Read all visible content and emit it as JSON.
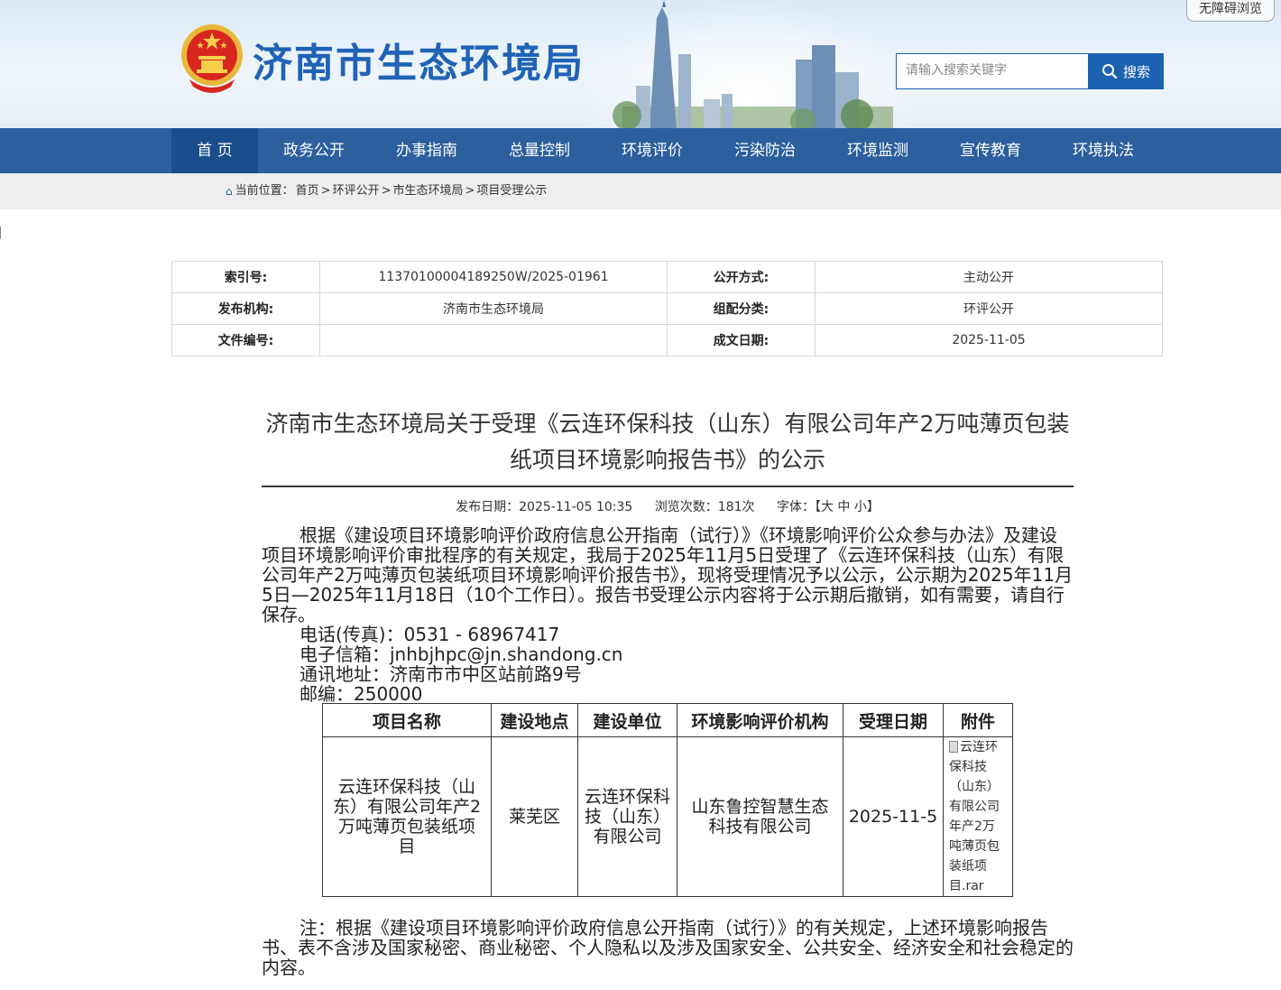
{
  "header": {
    "site_title": "济南市生态环境局",
    "accessibility_label": "无障碍浏览",
    "search": {
      "placeholder": "请输入搜索关键字",
      "button_label": "搜索"
    }
  },
  "nav": {
    "items": [
      "首 页",
      "政务公开",
      "办事指南",
      "总量控制",
      "环境评价",
      "污染防治",
      "环境监测",
      "宣传教育",
      "环境执法"
    ],
    "active": "首 页"
  },
  "breadcrumb": {
    "prefix": "当前位置：",
    "items": [
      "首页",
      "环评公开",
      "市生态环境局",
      "项目受理公示"
    ]
  },
  "meta_table": {
    "rows": [
      {
        "k1": "索引号:",
        "v1": "11370100004189250W/2025-01961",
        "k2": "公开方式:",
        "v2": "主动公开"
      },
      {
        "k1": "发布机构:",
        "v1": "济南市生态环境局",
        "k2": "组配分类:",
        "v2": "环评公开"
      },
      {
        "k1": "文件编号:",
        "v1": "",
        "k2": "成文日期:",
        "v2": "2025-11-05"
      }
    ]
  },
  "article": {
    "title": "济南市生态环境局关于受理《云连环保科技（山东）有限公司年产2万吨薄页包装纸项目环境影响报告书》的公示",
    "publish_date": "发布日期：2025-11-05 10:35",
    "views": "浏览次数：181次",
    "font_size": "字体：【大 中 小】",
    "paragraph": "根据《建设项目环境影响评价政府信息公开指南（试行）》《环境影响评价公众参与办法》及建设项目环境影响评价审批程序的有关规定，我局于2025年11月5日受理了《云连环保科技（山东）有限公司年产2万吨薄页包装纸项目环境影响评价报告书》，现将受理情况予以公示，公示期为2025年11月5日—2025年11月18日（10个工作日）。报告书受理公示内容将于公示期后撤销，如有需要，请自行保存。",
    "phone": "电话(传真)：0531 - 68967417",
    "email": "电子信箱：jnhbjhpc@jn.shandong.cn",
    "address": "通讯地址：济南市市中区站前路9号",
    "postcode": "邮编：250000",
    "note": "注：根据《建设项目环境影响评价政府信息公开指南（试行）》的有关规定，上述环境影响报告书、表不含涉及国家秘密、商业秘密、个人隐私以及涉及国家安全、公共安全、经济安全和社会稳定的内容。"
  },
  "project_table": {
    "headers": [
      "项目名称",
      "建设地点",
      "建设单位",
      "环境影响评价机构",
      "受理日期",
      "附件"
    ],
    "row": {
      "name": "云连环保科技（山东）有限公司年产2万吨薄页包装纸项目",
      "location": "莱芜区",
      "builder": "云连环保科技（山东）有限公司",
      "eia_org": "山东鲁控智慧生态科技有限公司",
      "date": "2025-11-5",
      "attachment": "云连环保科技（山东）有限公司年产2万吨薄页包装纸项目.rar"
    }
  },
  "colors": {
    "brand_blue": "#1b62b0",
    "nav_bg": "#2b5f9e",
    "nav_active": "#1a4d8c"
  }
}
